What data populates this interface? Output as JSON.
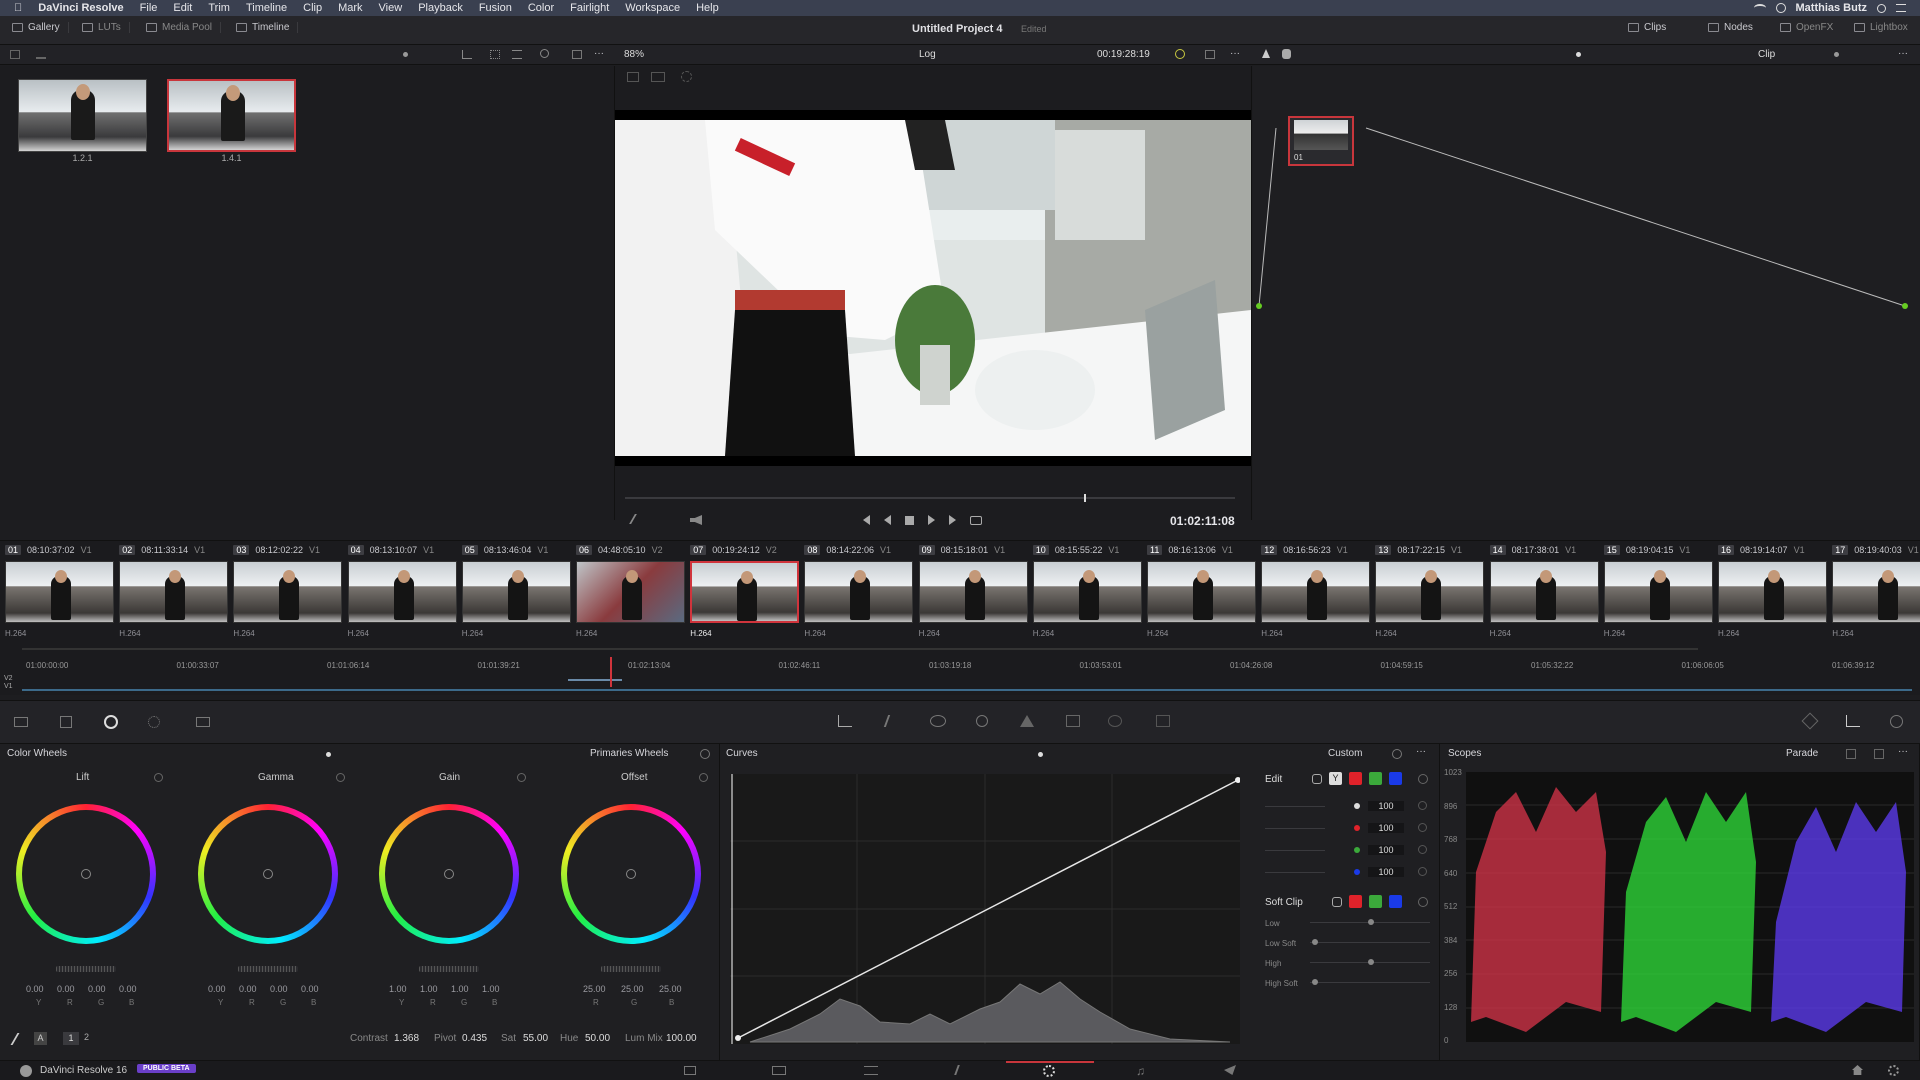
{
  "menu": {
    "apple": "",
    "app": "DaVinci Resolve",
    "items": [
      "File",
      "Edit",
      "Trim",
      "Timeline",
      "Clip",
      "Mark",
      "View",
      "Playback",
      "Fusion",
      "Color",
      "Fairlight",
      "Workspace",
      "Help"
    ],
    "user": "Matthias Butz"
  },
  "toolbar": {
    "gallery": "Gallery",
    "luts": "LUTs",
    "media_pool": "Media Pool",
    "timeline": "Timeline",
    "project": "Untitled Project 4",
    "edited": "Edited",
    "clips": "Clips",
    "nodes": "Nodes",
    "openfx": "OpenFX",
    "lightbox": "Lightbox"
  },
  "viewerbar": {
    "zoom": "88%",
    "mode": "Log",
    "timecode": "00:19:28:19",
    "clip_mode": "Clip"
  },
  "gallery": {
    "stills": [
      {
        "label": "1.2.1"
      },
      {
        "label": "1.4.1"
      }
    ]
  },
  "viewer": {
    "timecode": "01:02:11:08"
  },
  "node": {
    "label": "01"
  },
  "clips": [
    {
      "n": "01",
      "tc": "08:10:37:02",
      "track": "V1",
      "codec": "H.264"
    },
    {
      "n": "02",
      "tc": "08:11:33:14",
      "track": "V1",
      "codec": "H.264"
    },
    {
      "n": "03",
      "tc": "08:12:02:22",
      "track": "V1",
      "codec": "H.264"
    },
    {
      "n": "04",
      "tc": "08:13:10:07",
      "track": "V1",
      "codec": "H.264"
    },
    {
      "n": "05",
      "tc": "08:13:46:04",
      "track": "V1",
      "codec": "H.264"
    },
    {
      "n": "06",
      "tc": "04:48:05:10",
      "track": "V2",
      "codec": "H.264"
    },
    {
      "n": "07",
      "tc": "00:19:24:12",
      "track": "V2",
      "codec": "H.264"
    },
    {
      "n": "08",
      "tc": "08:14:22:06",
      "track": "V1",
      "codec": "H.264"
    },
    {
      "n": "09",
      "tc": "08:15:18:01",
      "track": "V1",
      "codec": "H.264"
    },
    {
      "n": "10",
      "tc": "08:15:55:22",
      "track": "V1",
      "codec": "H.264"
    },
    {
      "n": "11",
      "tc": "08:16:13:06",
      "track": "V1",
      "codec": "H.264"
    },
    {
      "n": "12",
      "tc": "08:16:56:23",
      "track": "V1",
      "codec": "H.264"
    },
    {
      "n": "13",
      "tc": "08:17:22:15",
      "track": "V1",
      "codec": "H.264"
    },
    {
      "n": "14",
      "tc": "08:17:38:01",
      "track": "V1",
      "codec": "H.264"
    },
    {
      "n": "15",
      "tc": "08:19:04:15",
      "track": "V1",
      "codec": "H.264"
    },
    {
      "n": "16",
      "tc": "08:19:14:07",
      "track": "V1",
      "codec": "H.264"
    },
    {
      "n": "17",
      "tc": "08:19:40:03",
      "track": "V1",
      "codec": "H.264"
    }
  ],
  "ruler": {
    "marks": [
      "01:00:00:00",
      "01:00:33:07",
      "01:01:06:14",
      "01:01:39:21",
      "01:02:13:04",
      "01:02:46:11",
      "01:03:19:18",
      "01:03:53:01",
      "01:04:26:08",
      "01:04:59:15",
      "01:05:32:22",
      "01:06:06:05",
      "01:06:39:12"
    ],
    "v2": "V2",
    "v1": "V1"
  },
  "color_wheels": {
    "title": "Color Wheels",
    "mode": "Primaries Wheels",
    "wheels": [
      {
        "name": "Lift",
        "vals": [
          "0.00",
          "0.00",
          "0.00",
          "0.00"
        ],
        "letters": [
          "Y",
          "R",
          "G",
          "B"
        ]
      },
      {
        "name": "Gamma",
        "vals": [
          "0.00",
          "0.00",
          "0.00",
          "0.00"
        ],
        "letters": [
          "Y",
          "R",
          "G",
          "B"
        ]
      },
      {
        "name": "Gain",
        "vals": [
          "1.00",
          "1.00",
          "1.00",
          "1.00"
        ],
        "letters": [
          "Y",
          "R",
          "G",
          "B"
        ]
      },
      {
        "name": "Offset",
        "vals": [
          "25.00",
          "25.00",
          "25.00"
        ],
        "letters": [
          "R",
          "G",
          "B"
        ]
      }
    ],
    "contrast_label": "Contrast",
    "contrast": "1.368",
    "pivot_label": "Pivot",
    "pivot": "0.435",
    "sat_label": "Sat",
    "sat": "55.00",
    "hue_label": "Hue",
    "hue": "50.00",
    "lummix_label": "Lum Mix",
    "lummix": "100.00",
    "page1": "1",
    "page2": "2",
    "a_label": "A"
  },
  "curves": {
    "title": "Curves",
    "mode": "Custom",
    "edit": "Edit",
    "y_btn": "Y",
    "edit_vals": [
      "100",
      "100",
      "100",
      "100"
    ],
    "softclip": "Soft Clip",
    "low": "Low",
    "low_soft": "Low Soft",
    "high": "High",
    "high_soft": "High Soft"
  },
  "scopes": {
    "title": "Scopes",
    "mode": "Parade",
    "ticks": [
      "1023",
      "896",
      "768",
      "640",
      "512",
      "384",
      "256",
      "128",
      "0"
    ]
  },
  "status": {
    "app": "DaVinci Resolve 16",
    "badge": "PUBLIC BETA"
  },
  "colors": {
    "accent": "#c8363c",
    "badge": "#6a3fc9"
  }
}
